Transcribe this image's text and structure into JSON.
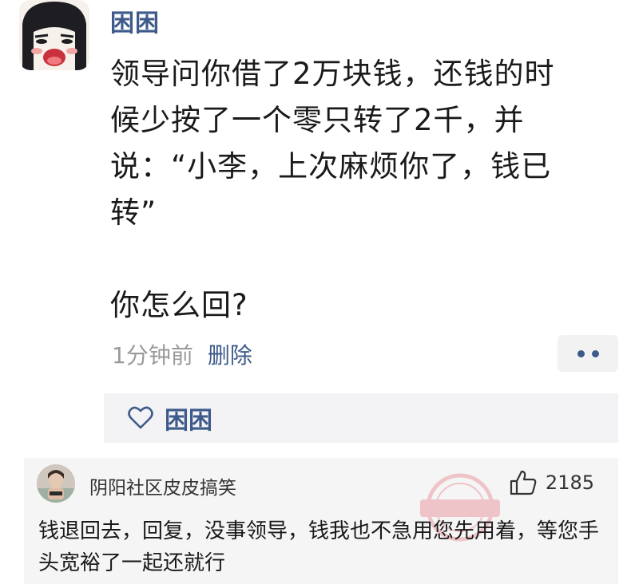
{
  "post": {
    "username": "困困",
    "text_lines": [
      "领导问你借了2万块钱，还钱的时",
      "候少按了一个零只转了2千，并",
      "说：“小李，上次麻烦你了，钱已",
      "转”"
    ],
    "question": "你怎么回?",
    "time": "1分钟前",
    "delete_label": "删除",
    "more_icon": "more-dots-icon",
    "like_icon": "heart-outline-icon",
    "liker": "困困",
    "colors": {
      "link": "#3d5a8a",
      "meta": "#9a9a9a",
      "panel": "#f3f3f5"
    }
  },
  "comment": {
    "username": "阴阳社区皮皮搞笑",
    "like_icon": "thumbs-up-icon",
    "like_count": "2185",
    "text": "钱退回去，回复，没事领导，钱我也不急用您先用着，等您手头宽裕了一起还就行",
    "watermark_icon": "shenpinglun-stamp-icon"
  }
}
